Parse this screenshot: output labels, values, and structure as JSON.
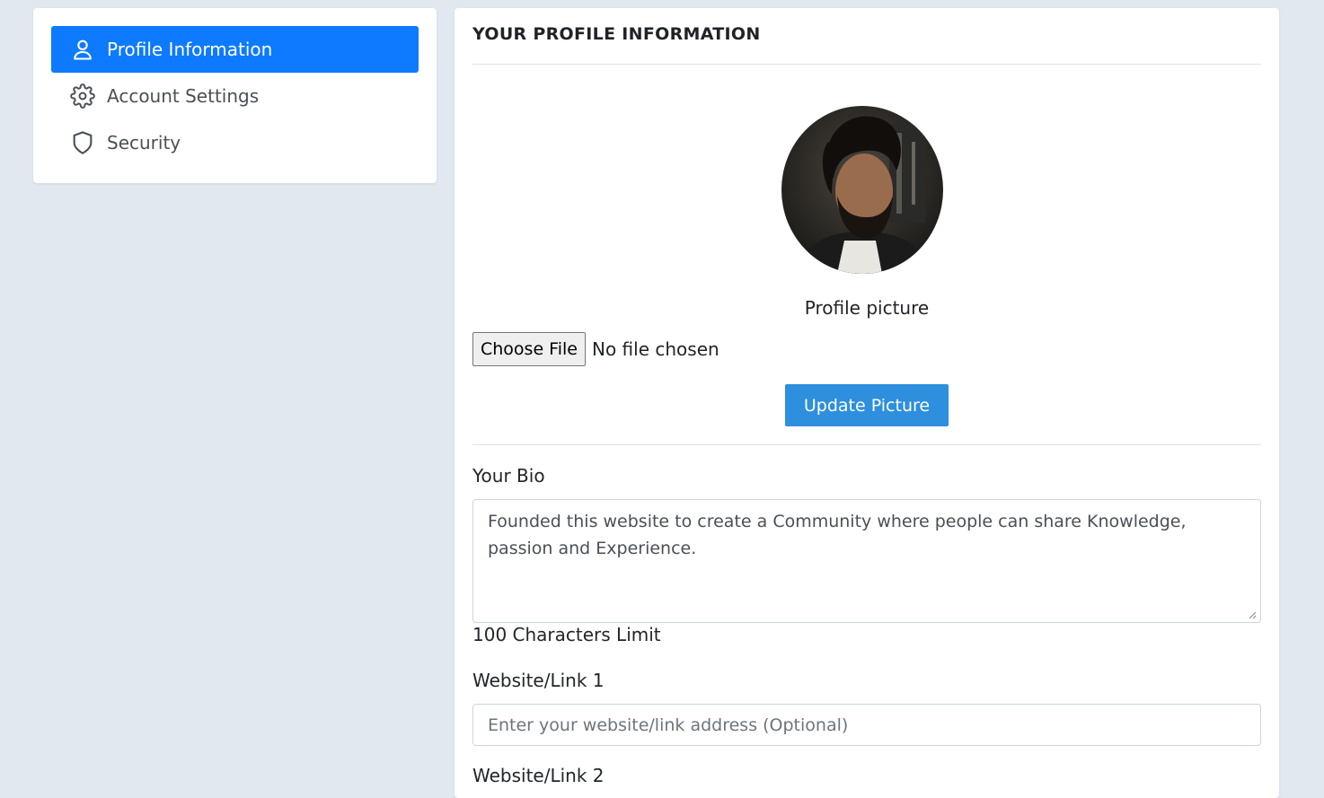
{
  "sidebar": {
    "items": [
      {
        "label": "Profile Information",
        "icon": "user-icon",
        "active": true
      },
      {
        "label": "Account Settings",
        "icon": "gear-icon",
        "active": false
      },
      {
        "label": "Security",
        "icon": "shield-icon",
        "active": false
      }
    ]
  },
  "main": {
    "title": "YOUR PROFILE INFORMATION",
    "picture": {
      "caption": "Profile picture",
      "choose_file_label": "Choose File",
      "file_status": "No file chosen",
      "update_label": "Update Picture"
    },
    "bio": {
      "label": "Your Bio",
      "value": "Founded this website to create a Community where people can share Knowledge, passion and Experience.",
      "helper": "100 Characters Limit"
    },
    "link1": {
      "label": "Website/Link 1",
      "placeholder": "Enter your website/link address (Optional)"
    },
    "link2": {
      "label": "Website/Link 2"
    }
  },
  "colors": {
    "active_nav": "#0d7aff",
    "update_button": "#2d8fdd",
    "background": "#e2e8f0"
  }
}
